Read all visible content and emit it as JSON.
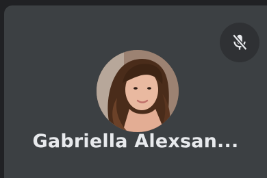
{
  "participant": {
    "name": "Gabriella Alexsan...",
    "mic_status_icon": "mic-off-icon",
    "avatar": "profile-photo"
  },
  "colors": {
    "tile_background": "#3c4043",
    "page_background": "#202124",
    "mute_button_background": "#2f3134",
    "name_text": "#e8eaed",
    "icon": "#e8eaed"
  }
}
